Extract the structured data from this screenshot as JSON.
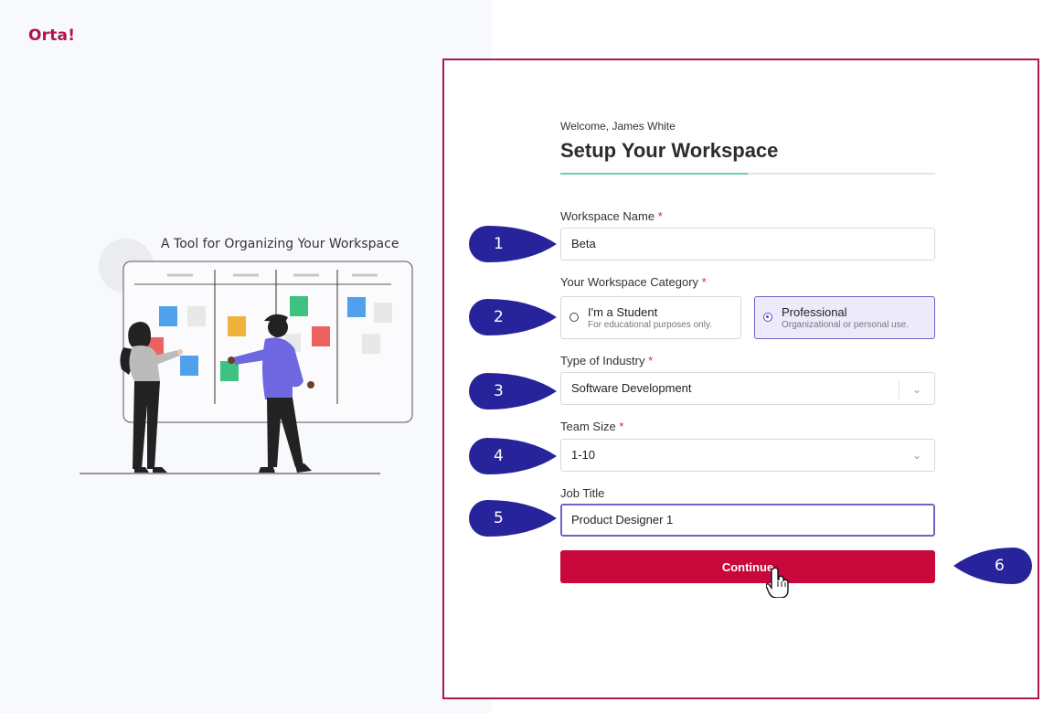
{
  "brand": {
    "logo_text": "Orta!"
  },
  "hero": {
    "tagline": "A Tool for Organizing Your Workspace"
  },
  "form": {
    "welcome": "Welcome, James White",
    "title": "Setup Your Workspace",
    "progress_fraction": 0.5,
    "workspace_name": {
      "label": "Workspace Name",
      "required": "*",
      "value": "Beta"
    },
    "category": {
      "label": "Your Workspace Category",
      "required": "*",
      "options": [
        {
          "title": "I'm a Student",
          "subtitle": "For educational purposes only.",
          "selected": false
        },
        {
          "title": "Professional",
          "subtitle": "Organizational or personal use.",
          "selected": true
        }
      ]
    },
    "industry": {
      "label": "Type of Industry",
      "required": "*",
      "value": "Software Development"
    },
    "team_size": {
      "label": "Team Size",
      "required": "*",
      "value": "1-10"
    },
    "job_title": {
      "label": "Job Title",
      "value": "Product Designer 1"
    },
    "continue_label": "Continue"
  },
  "markers": [
    "1",
    "2",
    "3",
    "4",
    "5",
    "6"
  ],
  "colors": {
    "brand": "#b0154f",
    "continue_button": "#c8073a",
    "selected_border": "#6b66c6",
    "marker": "#27239a",
    "progress": "#6ad1b0"
  },
  "icons": {
    "dropdown": "chevron-down-icon",
    "cursor": "hand-pointer-icon"
  }
}
